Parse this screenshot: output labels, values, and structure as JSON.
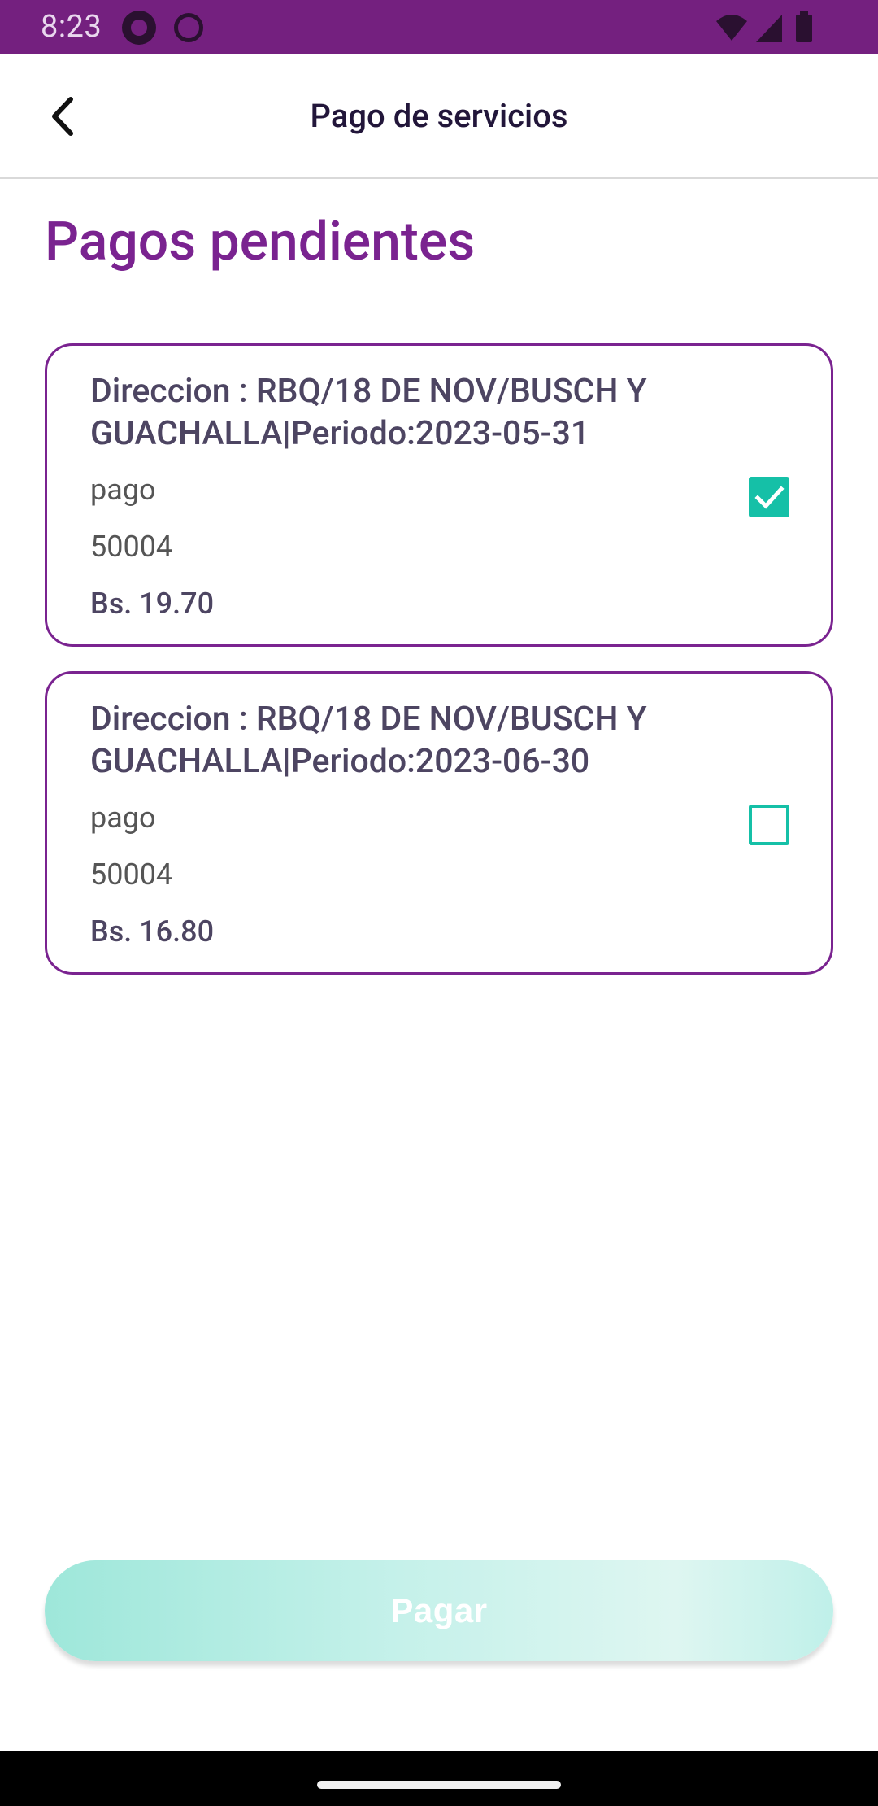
{
  "status_bar": {
    "time": "8:23",
    "bg_color": "#74207f",
    "icons": [
      "app-notification-icon",
      "android-debug-icon",
      "wifi-icon",
      "cell-signal-icon",
      "battery-icon"
    ]
  },
  "app_bar": {
    "title": "Pago de servicios",
    "back_icon": "chevron-left-icon"
  },
  "section_title": "Pagos pendientes",
  "payments": [
    {
      "address": "Direccion : RBQ/18 DE NOV/BUSCH Y GUACHALLA|Periodo:2023-05-31",
      "label": "pago",
      "code": "50004",
      "amount": "Bs. 19.70",
      "checked": true
    },
    {
      "address": "Direccion : RBQ/18 DE NOV/BUSCH Y GUACHALLA|Periodo:2023-06-30",
      "label": "pago",
      "code": "50004",
      "amount": "Bs. 16.80",
      "checked": false
    }
  ],
  "pay_button": {
    "label": "Pagar",
    "state": "disabled"
  },
  "colors": {
    "brand_purple": "#7a2390",
    "accent_teal": "#15c0a7",
    "status_bar": "#74207f"
  }
}
